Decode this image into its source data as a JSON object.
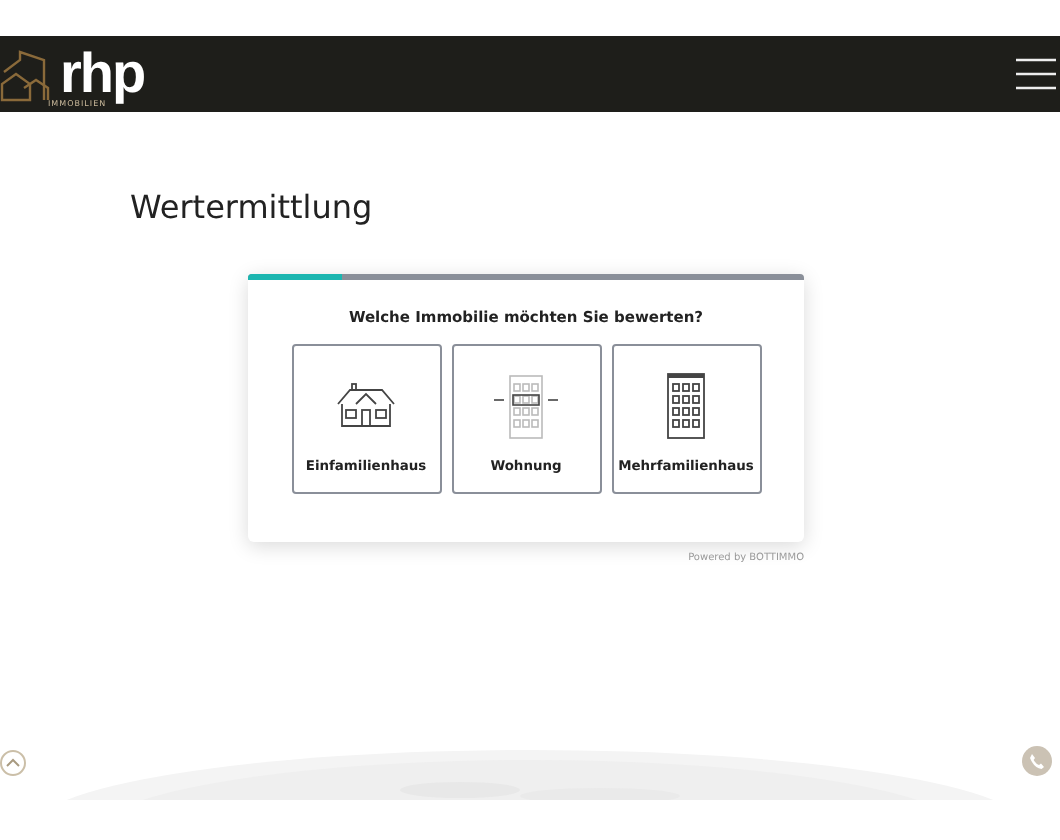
{
  "header": {
    "logo": "rhp",
    "logo_tagline": "IMMOBILIEN"
  },
  "title": "Wertermittlung",
  "wizard": {
    "progress": {
      "level": 0.17
    },
    "question": "Welche Immobilie möchten Sie bewerten?",
    "options": [
      {
        "kind": "house",
        "label": "Einfamilienhaus"
      },
      {
        "kind": "apartment",
        "label": "Wohnung"
      },
      {
        "kind": "building",
        "label": "Mehrfamilienhaus"
      }
    ],
    "powered_by": "Powered by BOTTIMMO"
  }
}
